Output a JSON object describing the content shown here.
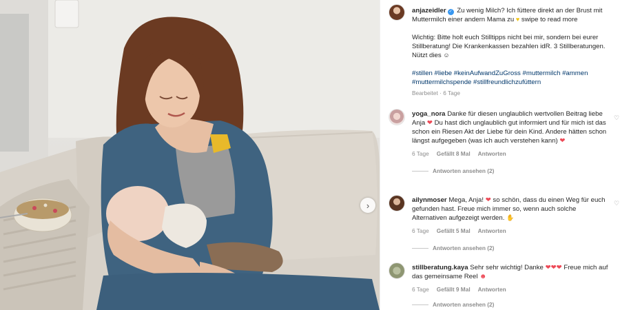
{
  "post": {
    "author": "anjazeidler",
    "caption_line1": "Zu wenig Milch? Ich füttere direkt an der Brust mit Muttermilch einer andern Mama zu",
    "caption_swipe": "swipe to read more",
    "caption_para2": "Wichtig: Bitte holt euch Stilltipps nicht bei mir, sondern bei eurer Stillberatung! Die Krankenkassen bezahlen idR. 3 Stillberatungen. Nützt dies",
    "hashtags": "#stillen #liebe #keinAufwandZuGross #muttermilch #ammen #muttermilchspende #stillfreundlichzufüttern",
    "edited": "Bearbeitet · 6 Tage"
  },
  "comments": [
    {
      "user": "yoga_nora",
      "text_a": "Danke für diesen unglaublich wertvollen Beitrag liebe Anja",
      "text_b": "Du hast dich unglaublich gut informiert und für mich ist das schon ein Riesen Akt der Liebe für dein Kind. Andere hätten schon längst aufgegeben (was ich auch verstehen kann)",
      "age": "6 Tage",
      "likes": "Gefällt 8 Mal",
      "reply": "Antworten",
      "view_replies": "Antworten ansehen (2)"
    },
    {
      "user": "ailynmoser",
      "text_a": "Mega, Anja!",
      "text_b": "so schön, dass du einen Weg für euch gefunden hast. Freue mich immer so, wenn auch solche Alternativen aufgezeigt werden.",
      "age": "6 Tage",
      "likes": "Gefällt 5 Mal",
      "reply": "Antworten",
      "view_replies": "Antworten ansehen (2)"
    },
    {
      "user": "stillberatung.kaya",
      "text_a": "Sehr sehr wichtig! Danke",
      "text_b": "Freue mich auf das gemeinsame Reel",
      "age": "6 Tage",
      "likes": "Gefällt 9 Mal",
      "reply": "Antworten",
      "view_replies": "Antworten ansehen (2)"
    }
  ],
  "icons": {
    "verified": "verified-badge-icon",
    "heart": "heart-icon",
    "next": "chevron-right-icon"
  },
  "colors": {
    "link": "#00376b",
    "verified": "#3897f0",
    "heart_red": "#ed4956",
    "meta": "#8e8e8e"
  }
}
